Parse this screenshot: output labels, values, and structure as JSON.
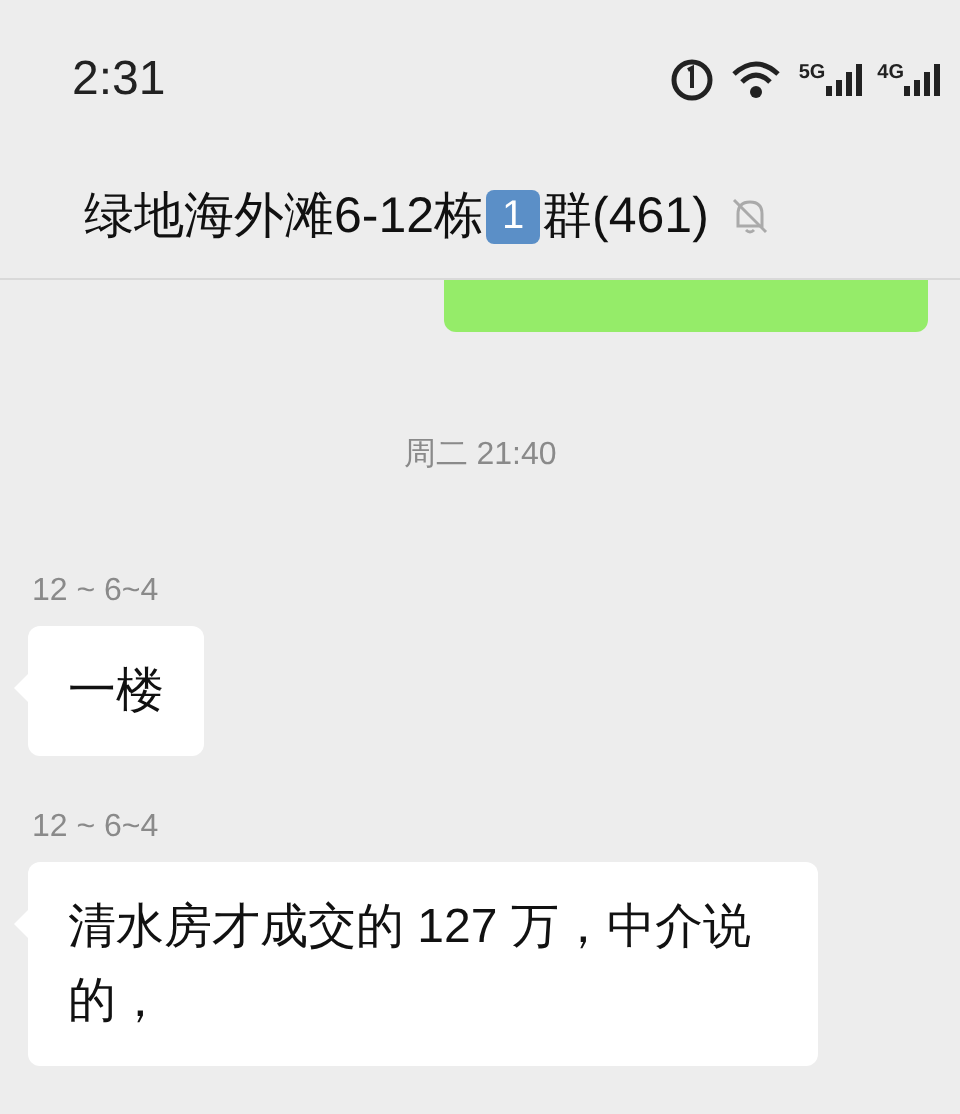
{
  "status_bar": {
    "time": "2:31",
    "network_labels": [
      "5G",
      "4G"
    ]
  },
  "header": {
    "title_prefix": "绿地海外滩6-12栋",
    "title_badge": "1",
    "title_suffix": "群(461)",
    "muted": true
  },
  "messages": [
    {
      "kind": "outgoing_cut"
    },
    {
      "kind": "time",
      "text": "周二 21:40"
    },
    {
      "kind": "incoming",
      "sender": "12 ~ 6~4",
      "text": "一楼"
    },
    {
      "kind": "incoming",
      "sender": "12 ~ 6~4",
      "text": "清水房才成交的 127 万，中介说的，"
    }
  ]
}
